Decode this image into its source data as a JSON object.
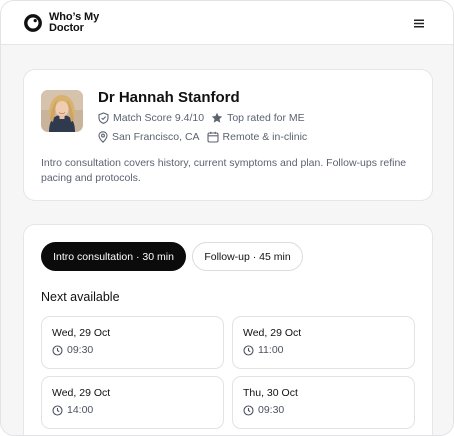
{
  "app": {
    "brand_line1": "Who’s My",
    "brand_line2": "Doctor"
  },
  "doctor": {
    "name": "Dr Hannah Stanford",
    "match_score": "Match Score 9.4/10",
    "rating_badge": "Top rated for ME",
    "location": "San Francisco, CA",
    "mode": "Remote & in-clinic",
    "description": "Intro consultation covers history, current symptoms and plan. Follow-ups refine pacing and protocols."
  },
  "booking": {
    "tabs": [
      {
        "label": "Intro consultation · 30 min",
        "active": true
      },
      {
        "label": "Follow-up · 45 min",
        "active": false
      }
    ],
    "next_available_title": "Next available",
    "slots": [
      {
        "date": "Wed, 29 Oct",
        "time": "09:30"
      },
      {
        "date": "Wed, 29 Oct",
        "time": "11:00"
      },
      {
        "date": "Wed, 29 Oct",
        "time": "14:00"
      },
      {
        "date": "Thu, 30 Oct",
        "time": "09:30"
      }
    ]
  },
  "colors": {
    "primary": "#0b0b0c",
    "muted_text": "#5b6270",
    "border": "#e6e6e9",
    "page_bg": "#f6f6f7"
  },
  "icons": [
    "logo-ring-icon",
    "menu-icon",
    "shield-check-icon",
    "star-icon",
    "map-pin-icon",
    "calendar-icon",
    "clock-icon"
  ]
}
